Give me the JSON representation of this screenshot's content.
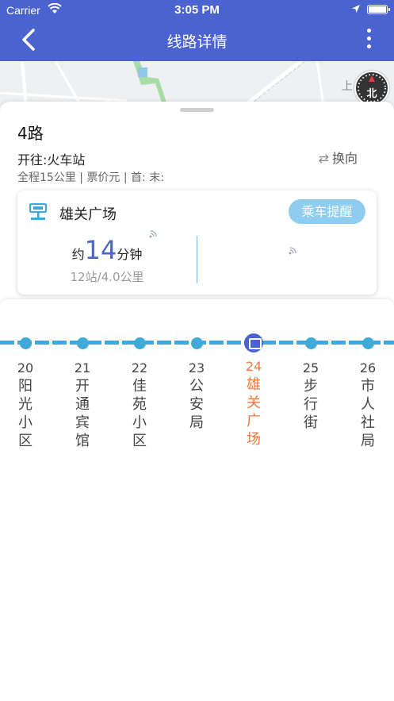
{
  "status_bar": {
    "carrier": "Carrier",
    "time": "3:05 PM"
  },
  "header": {
    "title": "线路详情",
    "back_icon": "chevron-left-icon",
    "more_icon": "more-vertical-icon"
  },
  "map": {
    "label": "上",
    "compass": "北"
  },
  "route": {
    "name": "4路",
    "direction": "开往:火车站",
    "switch_label": "换向",
    "meta": "全程15公里 | 票价元 | 首: 末:"
  },
  "stop_card": {
    "stop_name": "雄关广场",
    "remind_label": "乘车提醒",
    "eta_prefix": "约",
    "eta_value": "14",
    "eta_suffix": "分钟",
    "distance": "12站/4.0公里"
  },
  "stops": [
    {
      "num": "20",
      "name": "阳光小区",
      "current": false
    },
    {
      "num": "21",
      "name": "开通宾馆",
      "current": false
    },
    {
      "num": "22",
      "name": "佳苑小区",
      "current": false
    },
    {
      "num": "23",
      "name": "公安局",
      "current": false
    },
    {
      "num": "24",
      "name": "雄关广场",
      "current": true
    },
    {
      "num": "25",
      "name": "步行街",
      "current": false
    },
    {
      "num": "26",
      "name": "市人社局",
      "current": false
    }
  ],
  "colors": {
    "primary": "#4a63cf",
    "line": "#3fa9da",
    "current_stop": "#ef7a3b",
    "remind_button": "#8fcdf0"
  }
}
